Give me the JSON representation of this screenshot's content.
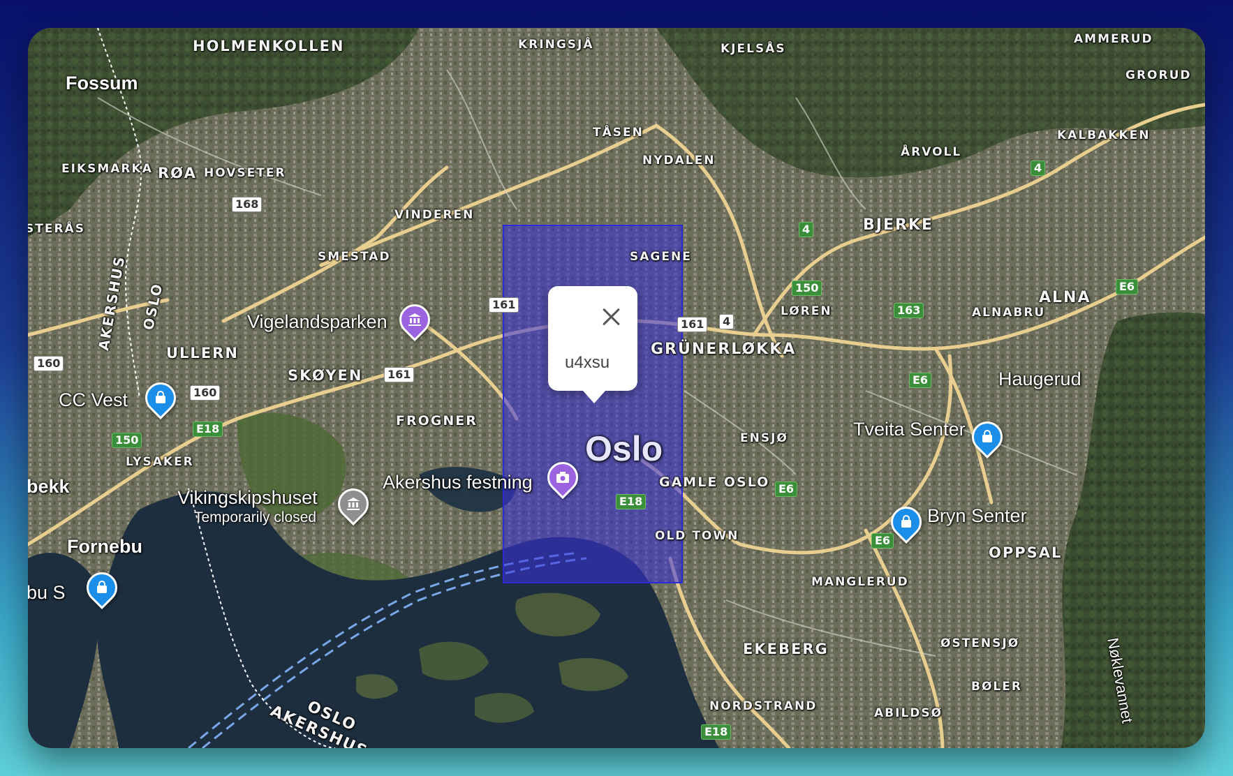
{
  "map": {
    "districts": [
      "HOLMENKOLLEN",
      "KRINGSJÅ",
      "KJELSÅS",
      "AMMERUD",
      "GRORUD",
      "TÅSEN",
      "NYDALEN",
      "ÅRVOLL",
      "KALBAKKEN",
      "EIKSMARKA",
      "RØA",
      "HOVSETER",
      "STERÅS",
      "VINDEREN",
      "SMESTAD",
      "SAGENE",
      "BJERKE",
      "LØREN",
      "ALNABRU",
      "ALNA",
      "ULLERN",
      "GRÜNERLØKKA",
      "SKØYEN",
      "FROGNER",
      "ENSJØ",
      "LYSAKER",
      "GAMLE OSLO",
      "OLD TOWN",
      "OPPSAL",
      "MANGLERUD",
      "ØSTENSJØ",
      "EKEBERG",
      "BØLER",
      "NORDSTRAND",
      "ABILDSØ",
      "OSLO",
      "AKERSHUS"
    ],
    "places": [
      "Fossum",
      "Vigelandsparken",
      "CC Vest",
      "Haugerud",
      "Tveita Senter",
      "Akershus festning",
      "Vikingskipshuset",
      "Bryn Senter",
      "bekk",
      "Fornebu",
      "bu S",
      "Nøklevannet"
    ],
    "city": "Oslo",
    "subtitle": "Temporarily closed",
    "road_shields": [
      "168",
      "161",
      "161",
      "161",
      "4",
      "160",
      "160",
      "150",
      "E18",
      "150",
      "163",
      "E6",
      "4",
      "4",
      "E6",
      "E18",
      "E6",
      "E6",
      "E18"
    ],
    "pins": [
      {
        "name": "Vigelandsparken",
        "icon": "museum-icon",
        "color": "#9b63e0"
      },
      {
        "name": "CC Vest",
        "icon": "shopping-bag-icon",
        "color": "#1a8ee8"
      },
      {
        "name": "Akershus festning",
        "icon": "camera-icon",
        "color": "#9b63e0"
      },
      {
        "name": "Vikingskipshuset",
        "icon": "museum-icon",
        "color": "#8f8f8f"
      },
      {
        "name": "Tveita Senter",
        "icon": "shopping-bag-icon",
        "color": "#1a8ee8"
      },
      {
        "name": "Bryn Senter",
        "icon": "shopping-bag-icon",
        "color": "#1a8ee8"
      },
      {
        "name": "bu S",
        "icon": "shopping-bag-icon",
        "color": "#1a8ee8"
      }
    ],
    "selection_color": "#3830dc"
  },
  "popup": {
    "text": "u4xsu",
    "close_icon": "close-icon"
  }
}
